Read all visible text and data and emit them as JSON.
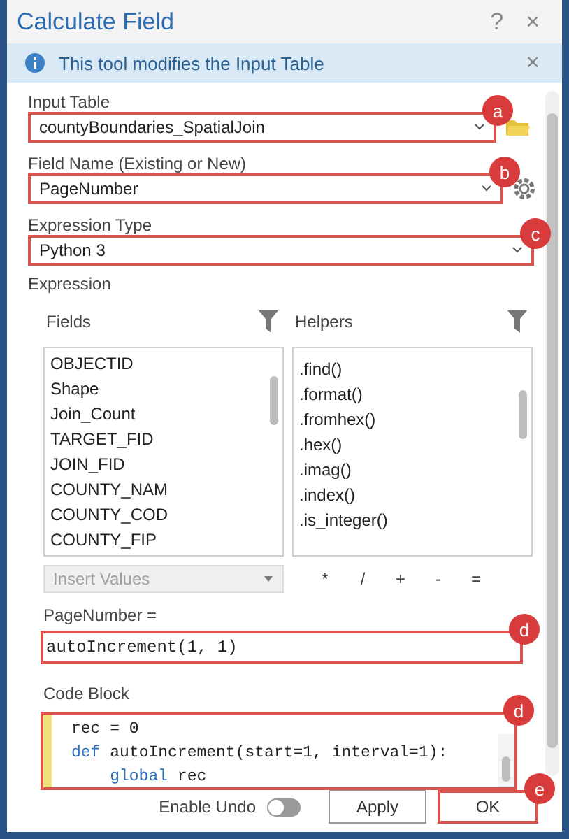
{
  "window": {
    "title": "Calculate Field",
    "help": "?",
    "close": "×"
  },
  "info_bar": {
    "message": "This tool modifies the Input Table",
    "close": "×"
  },
  "input_table": {
    "label": "Input Table",
    "value": "countyBoundaries_SpatialJoin",
    "callout": "a"
  },
  "field_name": {
    "label": "Field Name (Existing or New)",
    "value": "PageNumber",
    "callout": "b"
  },
  "expression_type": {
    "label": "Expression Type",
    "value": "Python 3",
    "callout": "c"
  },
  "expression": {
    "label": "Expression",
    "fields": {
      "label": "Fields",
      "items": [
        "OBJECTID",
        "Shape",
        "Join_Count",
        "TARGET_FID",
        "JOIN_FID",
        "COUNTY_NAM",
        "COUNTY_COD",
        "COUNTY_FIP"
      ]
    },
    "helpers": {
      "label": "Helpers",
      "items": [
        ".find()",
        ".format()",
        ".fromhex()",
        ".hex()",
        ".imag()",
        ".index()",
        ".is_integer()"
      ]
    },
    "insert_values": {
      "placeholder": "Insert Values",
      "disabled": true
    },
    "operators": [
      "*",
      "/",
      "+",
      "-",
      "="
    ],
    "target_label": "PageNumber =",
    "value": "autoIncrement(1, 1)",
    "callout": "d"
  },
  "code_block": {
    "label": "Code Block",
    "callout": "d",
    "lines": [
      [
        {
          "kind": "plain",
          "text": "rec = 0"
        }
      ],
      [
        {
          "kind": "keyword",
          "text": "def"
        },
        {
          "kind": "plain",
          "text": " autoIncrement(start=1, interval=1):"
        }
      ],
      [
        {
          "kind": "indent"
        },
        {
          "kind": "keyword",
          "text": "global"
        },
        {
          "kind": "plain",
          "text": " rec"
        }
      ]
    ]
  },
  "footer": {
    "enable_undo": {
      "label": "Enable Undo",
      "on": false
    },
    "apply": "Apply",
    "ok": "OK",
    "ok_callout": "e"
  }
}
